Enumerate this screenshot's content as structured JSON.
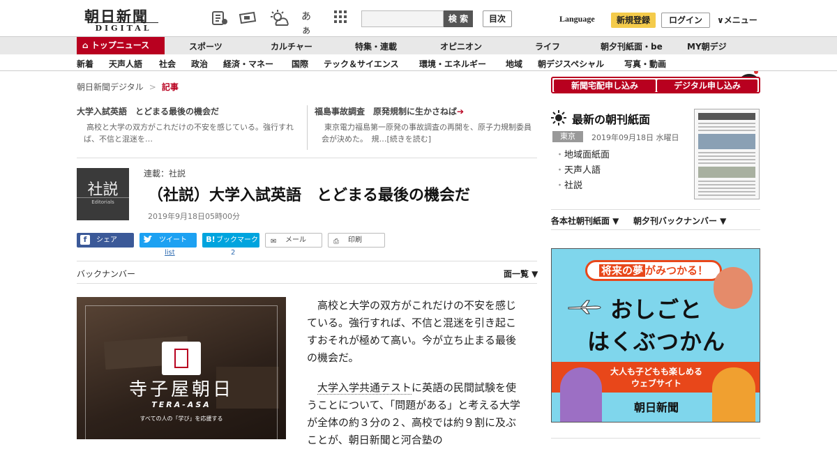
{
  "header": {
    "logo_main": "朝日新聞",
    "logo_sub": "DIGITAL",
    "kana_toggle": "あぁ",
    "search_button": "検 索",
    "toc_button": "目次",
    "language": "Language",
    "register": "新規登録",
    "login": "ログイン",
    "menu": "∨メニュー"
  },
  "nav_main": {
    "top": "トップニュース",
    "items": [
      "スポーツ",
      "カルチャー",
      "特集・連載",
      "オピニオン",
      "ライフ",
      "朝夕刊紙面・be",
      "MY朝デジ"
    ]
  },
  "nav_sub": {
    "items": [
      "新着",
      "天声人語",
      "社会",
      "政治",
      "経済・マネー",
      "国際",
      "テック＆サイエンス",
      "環境・エネルギー",
      "地域",
      "朝デジスペシャル",
      "写真・動画"
    ]
  },
  "breadcrumb": {
    "home": "朝日新聞デジタル",
    "sep": ">",
    "current": "記事"
  },
  "related": [
    {
      "title": "大学入試英語　とどまる最後の機会だ",
      "desc": "高校と大学の双方がこれだけの不安を感じている。強行すれば、不信と混迷を…"
    },
    {
      "title": "福島事故調査　原発規制に生かさねば",
      "arrow": "➔",
      "desc": "東京電力福島第一原発の事故調査の再開を、原子力規制委員会が決めた。　規…[続きを読む]"
    }
  ],
  "article": {
    "thumb_kanji": "社説",
    "thumb_en": "Editorials",
    "series": "連載：社説",
    "title": "（社説）大学入試英語　とどまる最後の機会だ",
    "date": "2019年9月18日05時00分",
    "backnumber": "バックナンバー",
    "menu_list": "面一覧 ▼",
    "paragraph1": "高校と大学の双方がこれだけの不安を感じている。強行すれば、不信と混迷を引き起こすおそれが極めて高い。今が立ち止まる最後の機会だ。",
    "paragraph2_link": "大学入学共通テスト",
    "paragraph2_rest": "に英語の民間試験を使うことについて、「問題がある」と考える大学が全体の約３分の２、高校では約９割に及ぶことが、朝日新聞と河合塾の"
  },
  "share": {
    "facebook": "シェア",
    "twitter": "ツイート",
    "twitter_count": "list",
    "hatena": "ブックマーク",
    "hatena_icon": "B!",
    "hatena_count": "2",
    "mail": "メール",
    "print": "印刷"
  },
  "promo": {
    "name": "寺子屋朝日",
    "roman": "TERA-ASA",
    "tagline": "すべての人の「学び」を応援する"
  },
  "sidebar": {
    "btn_delivery": "新聞宅配申し込み",
    "btn_digital": "デジタル申し込み",
    "paper_title": "最新の朝刊紙面",
    "region": "東京",
    "paper_date": "2019年09月18日 水曜日",
    "paper_links": [
      "地域面紙面",
      "天声人語",
      "社説"
    ],
    "link_regional": "各本社朝刊紙面 ▼",
    "link_evening": "朝夕刊バックナンバー ▼"
  },
  "ad": {
    "banner_pre": "将来の夢",
    "banner_post": "がみつかる！",
    "title1": "おしごと",
    "title2": "はくぶつかん",
    "sub1": "大人も子どもも楽しめる",
    "sub2": "ウェブサイト",
    "brand": "朝日新聞"
  },
  "colors": {
    "brand_red": "#b8001f",
    "register_yellow": "#f4cb4b",
    "facebook": "#3b5998",
    "twitter": "#1da1f2",
    "hatena": "#00a4de",
    "ad_bg": "#7fd6ec",
    "ad_accent": "#e8471a"
  }
}
